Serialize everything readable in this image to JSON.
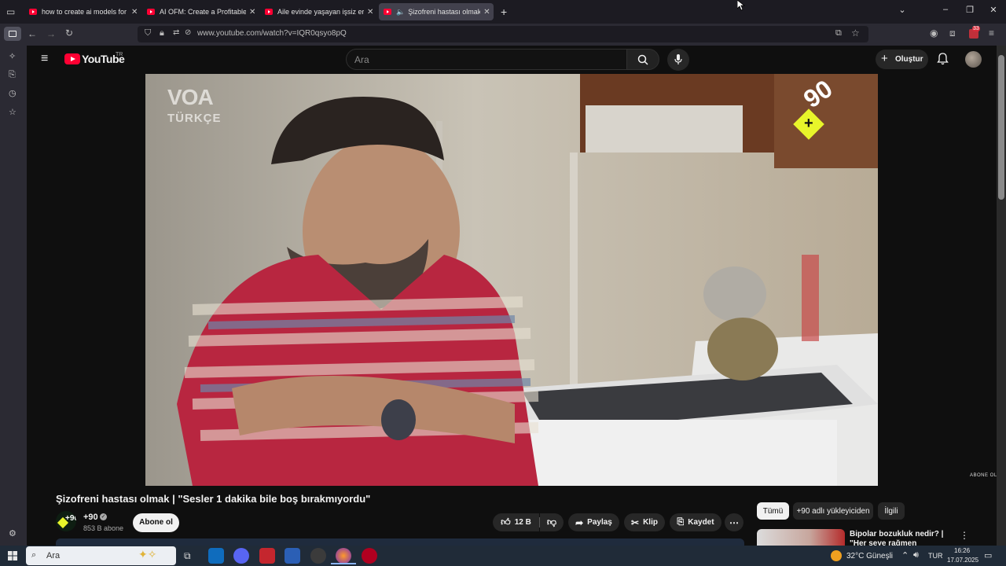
{
  "browser": {
    "tabs": [
      {
        "title": "how to create ai models for onl",
        "active": false
      },
      {
        "title": "AI OFM: Create a Profitable AI I",
        "active": false
      },
      {
        "title": "Aile evinde yaşayan işsiz erkek ·",
        "active": false
      },
      {
        "title": "Şizofreni hastası olmak | \"Se",
        "active": true
      }
    ],
    "url": "www.youtube.com/watch?v=IQR0qsyo8pQ",
    "extension_badge": "33"
  },
  "youtube": {
    "logo_text": "YouTube",
    "region": "TR",
    "search_placeholder": "Ara",
    "create_label": "Oluştur"
  },
  "video": {
    "watermark_line1": "VOA",
    "watermark_line2": "TÜRKÇE",
    "channel_logo": "+90",
    "corner_text": "ABONE OL",
    "title": "Şizofreni hastası olmak | \"Sesler 1 dakika bile boş bırakmıyordu\""
  },
  "channel": {
    "name": "+90",
    "subscribers": "853 B abone",
    "subscribe_label": "Abone ol"
  },
  "actions": {
    "likes": "12 B",
    "share": "Paylaş",
    "clip": "Klip",
    "save": "Kaydet"
  },
  "chips": [
    "Tümü",
    "+90 adlı yükleyiciden",
    "İlgili"
  ],
  "related": {
    "title": "Bipolar bozukluk nedir? | \"Her şeye rağmen umudumu hiç"
  },
  "taskbar": {
    "search_placeholder": "Ara",
    "weather": "32°C  Güneşli",
    "language": "TUR",
    "time": "16:26",
    "date": "17.07.2025"
  },
  "colors": {
    "youtube_red": "#ff0033",
    "plus90_yellow": "#e8f52a",
    "page_bg": "#0f0f0f"
  }
}
